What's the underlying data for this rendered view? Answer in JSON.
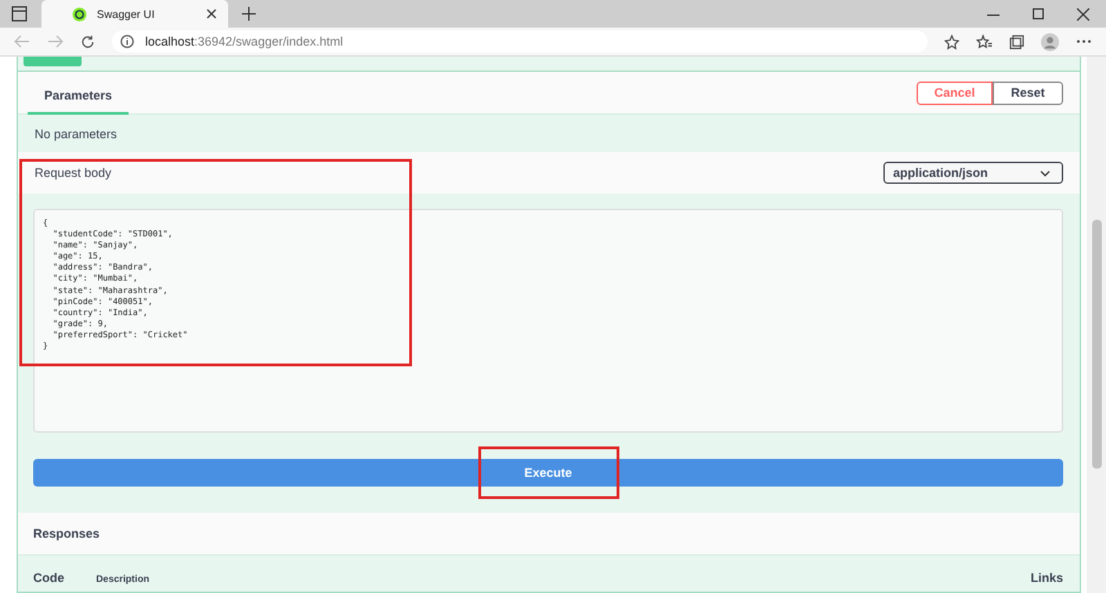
{
  "browser": {
    "tab_title": "Swagger UI",
    "url_host": "localhost",
    "url_rest": ":36942/swagger/index.html"
  },
  "parameters": {
    "tab": "Parameters",
    "selected": true,
    "cancel": "Cancel",
    "reset": "Reset",
    "empty_text": "No parameters"
  },
  "request_body": {
    "label": "Request body",
    "content_type": "application/json",
    "highlighted": true,
    "value": "{\n  \"studentCode\": \"STD001\",\n  \"name\": \"Sanjay\",\n  \"age\": 15,\n  \"address\": \"Bandra\",\n  \"city\": \"Mumbai\",\n  \"state\": \"Maharashtra\",\n  \"pinCode\": \"400051\",\n  \"country\": \"India\",\n  \"grade\": 9,\n  \"preferredSport\": \"Cricket\"\n}"
  },
  "execute_button": {
    "label": "Execute",
    "highlighted": true
  },
  "responses": {
    "title": "Responses",
    "columns": [
      "Code",
      "Description",
      "Links"
    ]
  }
}
